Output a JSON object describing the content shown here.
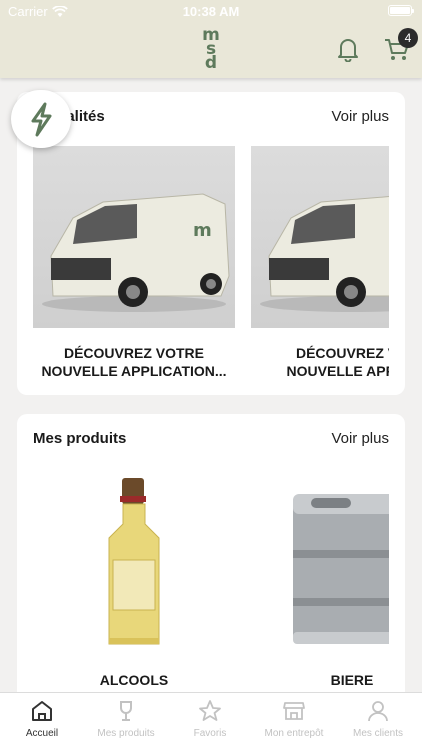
{
  "status_bar": {
    "carrier": "Carrier",
    "time": "10:38 AM"
  },
  "header": {
    "logo_letters": [
      "m",
      "s",
      "d"
    ],
    "cart_count": "4"
  },
  "news": {
    "title": "Actualités",
    "more_label": "Voir plus",
    "items": [
      {
        "caption_line1": "DÉCOUVREZ VOTRE",
        "caption_line2": "NOUVELLE APPLICATION..."
      },
      {
        "caption_line1": "DÉCOUVREZ VO",
        "caption_line2": "NOUVELLE APPLIC"
      }
    ]
  },
  "products": {
    "title": "Mes produits",
    "more_label": "Voir plus",
    "items": [
      {
        "label": "ALCOOLS"
      },
      {
        "label": "BIERE"
      }
    ]
  },
  "tabs": [
    {
      "label": "Accueil",
      "icon": "home-icon",
      "active": true
    },
    {
      "label": "Mes produits",
      "icon": "wine-glass-icon",
      "active": false
    },
    {
      "label": "Favoris",
      "icon": "star-icon",
      "active": false
    },
    {
      "label": "Mon entrepôt",
      "icon": "store-icon",
      "active": false
    },
    {
      "label": "Mes clients",
      "icon": "person-icon",
      "active": false
    }
  ],
  "colors": {
    "header_bg": "#e9e7d8",
    "brand_green": "#5e7a5c",
    "badge_bg": "#2b2b2b"
  }
}
